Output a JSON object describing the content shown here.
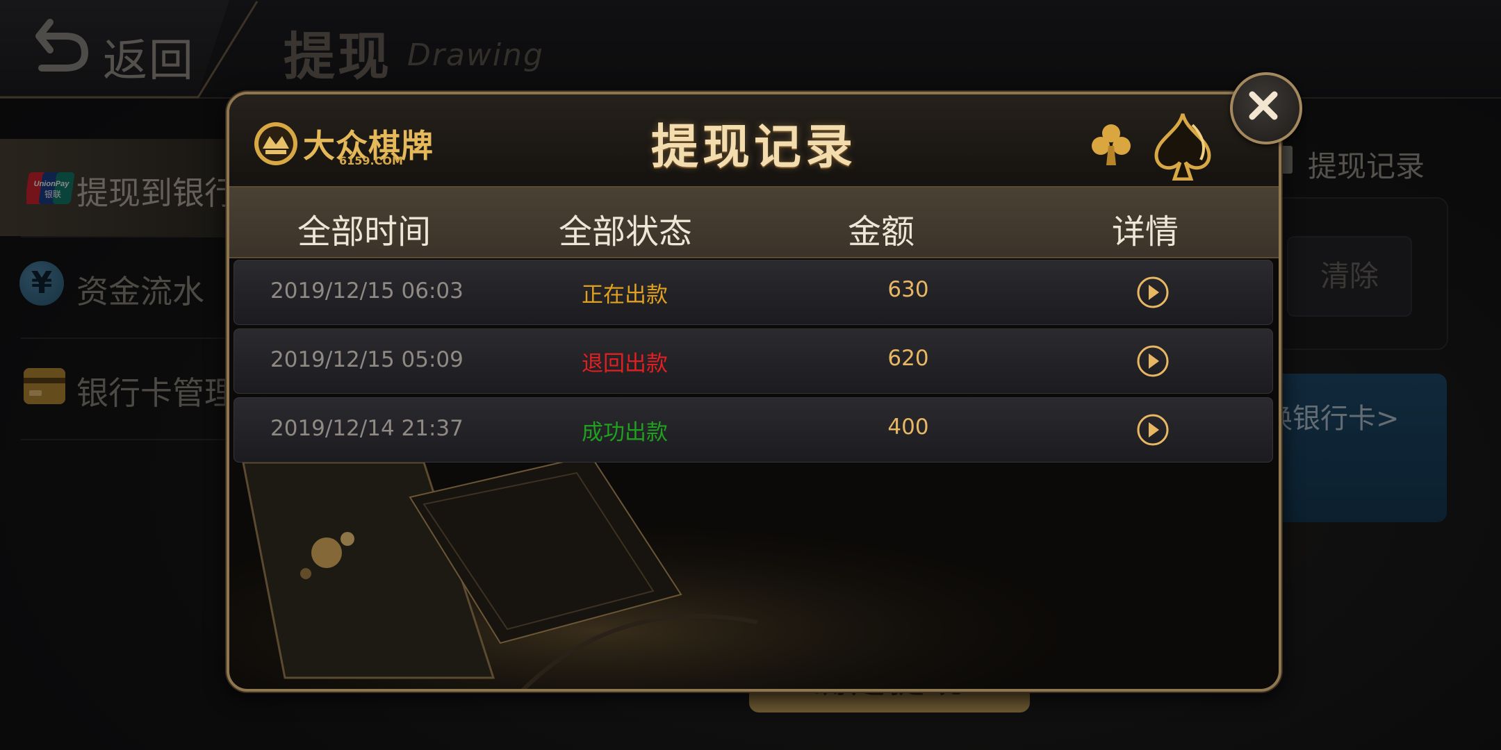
{
  "header": {
    "back_label": "返回",
    "title": "提现",
    "subtitle": "Drawing"
  },
  "sidebar": {
    "items": [
      {
        "label": "提现到银行",
        "icon": "unionpay-icon",
        "active": true
      },
      {
        "label": "资金流水",
        "icon": "yuan-icon",
        "active": false
      },
      {
        "label": "银行卡管理",
        "icon": "bank-card-icon",
        "active": false
      }
    ]
  },
  "right_panel": {
    "record_label": "提现记录",
    "clear_label": "清除",
    "bank_text": "换银行卡>",
    "confirm_label": "确定提现"
  },
  "modal": {
    "brand_name": "大众棋牌",
    "brand_domain": "6159.COM",
    "title": "提现记录",
    "columns": [
      "全部时间",
      "全部状态",
      "金额",
      "详情"
    ],
    "rows": [
      {
        "time": "2019/12/15 06:03",
        "status": "正在出款",
        "status_color": "#e0a020",
        "amount": "630"
      },
      {
        "time": "2019/12/15 05:09",
        "status": "退回出款",
        "status_color": "#e02020",
        "amount": "620"
      },
      {
        "time": "2019/12/14 21:37",
        "status": "成功出款",
        "status_color": "#1fa01f",
        "amount": "400"
      }
    ]
  },
  "colors": {
    "accent_gold": "#e8b764",
    "frame_gold": "#8e7650"
  }
}
